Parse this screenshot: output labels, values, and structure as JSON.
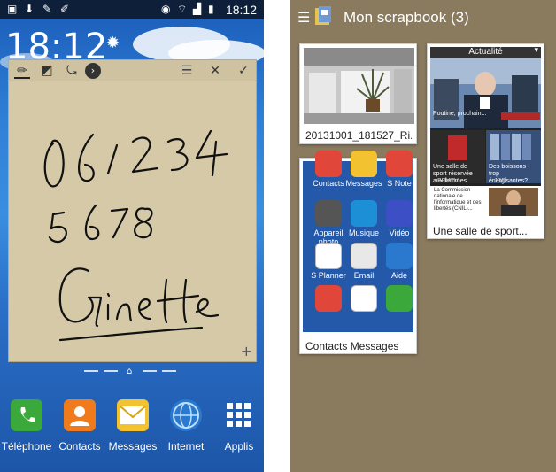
{
  "left_phone": {
    "status_time": "18:12",
    "clock": "18:12",
    "note": {
      "handwriting": [
        "0 6 1 2 3 4",
        "5 6 7 8",
        "Ginette"
      ]
    },
    "dock": [
      {
        "label": "Téléphone",
        "icon": "phone-icon",
        "color": "#3aa83a"
      },
      {
        "label": "Contacts",
        "icon": "contacts-icon",
        "color": "#f07b1d"
      },
      {
        "label": "Messages",
        "icon": "messages-icon",
        "color": "#f2c230"
      },
      {
        "label": "Internet",
        "icon": "internet-icon",
        "color": "#2a79cf"
      },
      {
        "label": "Applis",
        "icon": "apps-grid-icon",
        "color": "#ffffff"
      }
    ]
  },
  "right_phone": {
    "title": "Mon scrapbook (3)",
    "cards": {
      "photo_caption": "20131001_181527_Ri...",
      "news_header": "Actualité",
      "news_items": [
        "Poutine, prochain...",
        "Une salle de sport réservée aux femmes",
        "Des boissons trop énergisantes?",
        "La Commission nationale de l'informatique et des libertés (CNIL)..."
      ],
      "news_sources": [
        "BFMTV",
        "JDD"
      ],
      "news_caption": "Une salle de sport...",
      "apps_caption": "Contacts  Messages"
    },
    "apps": [
      {
        "label": "Contacts",
        "color": "#e0473a"
      },
      {
        "label": "Messages",
        "color": "#f2c230"
      },
      {
        "label": "S Note",
        "color": "#e0473a"
      },
      {
        "label": "Appareil photo",
        "color": "#555555"
      },
      {
        "label": "Musique",
        "color": "#1d8fd6"
      },
      {
        "label": "Vidéo",
        "color": "#3d4fc4"
      },
      {
        "label": "S Planner",
        "color": "#ffffff"
      },
      {
        "label": "Email",
        "color": "#e8e8e8"
      },
      {
        "label": "Aide",
        "color": "#2a79cf"
      },
      {
        "label": "",
        "color": "#e0473a"
      },
      {
        "label": "",
        "color": "#ffffff"
      },
      {
        "label": "",
        "color": "#3aa83a"
      }
    ]
  }
}
